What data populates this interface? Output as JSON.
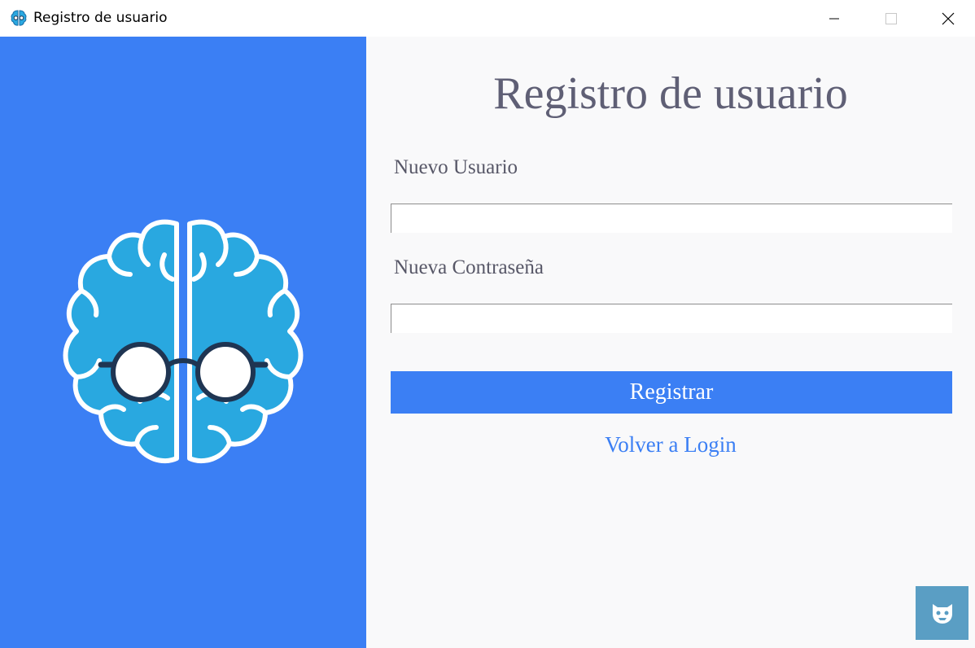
{
  "window": {
    "title": "Registro de usuario",
    "icon": "brain-icon",
    "controls": [
      "minimize-icon",
      "maximize-icon",
      "close-icon"
    ]
  },
  "left_panel": {
    "background": "#3b7ff4",
    "illustration": "brain-with-glasses-icon"
  },
  "form": {
    "heading": "Registro de usuario",
    "user_label": "Nuevo Usuario",
    "user_value": "",
    "password_label": "Nueva Contraseña",
    "password_value": "",
    "submit_label": "Registrar",
    "back_link": "Volver a Login"
  },
  "corner_widget": {
    "icon": "mascot-icon",
    "background": "#5a9ec4"
  },
  "colors": {
    "accent": "#3b7ff4",
    "heading": "#5f5f75",
    "label": "#575767",
    "panel_bg": "#f9f9fa"
  }
}
